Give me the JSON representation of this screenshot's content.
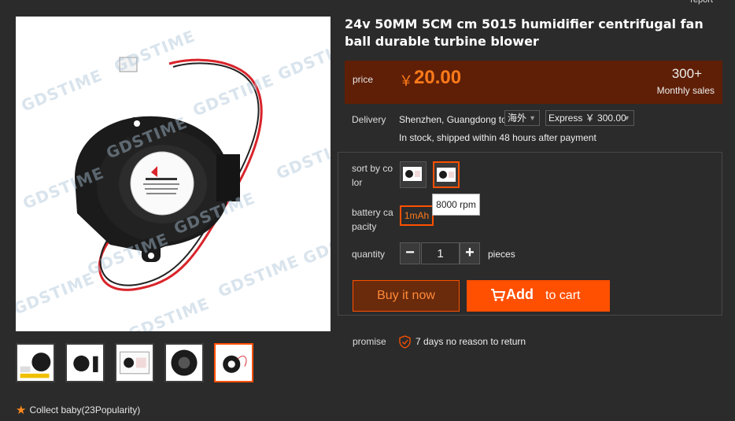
{
  "header": {
    "report_link": "report"
  },
  "product": {
    "title": "24v 50MM 5CM cm 5015 humidifier centrifugal fan ball durable turbine blower",
    "watermark": "GDSTIME",
    "fan_label": "GDSTIME"
  },
  "gallery": {
    "thumbnail_count": 5,
    "active_index": 4
  },
  "collect": {
    "label": "Collect baby(23Popularity)",
    "star_icon": "star-icon"
  },
  "price": {
    "label": "price",
    "currency_symbol": "￥",
    "value": "20.00",
    "sales_count": "300+",
    "sales_label": "Monthly sales",
    "background_color": "#5f1f06",
    "accent_color": "#ff7a1a"
  },
  "delivery": {
    "label": "Delivery",
    "from": "Shenzhen, Guangdong to",
    "destination": "海外",
    "shipping_option": "Express ￥ 300.00",
    "stock_text": "In stock, shipped within 48 hours after payment"
  },
  "options": {
    "color_label_line1": "sort by co",
    "color_label_line2": "lor",
    "color_swatch_count": 2,
    "selected_color_index": 1,
    "battery_label_line1": "battery ca",
    "battery_label_line2": "pacity",
    "battery_value": "1mAh",
    "tooltip": "8000 rpm",
    "quantity_label": "quantity",
    "quantity_value": "1",
    "quantity_unit": "pieces",
    "minus_symbol": "−",
    "plus_symbol": "+"
  },
  "actions": {
    "buy_label": "Buy it now",
    "add_label": "Add",
    "to_cart_label": "to cart",
    "primary_color": "#ff4f00"
  },
  "promise": {
    "label": "promise",
    "text": "7 days no reason to return",
    "icon": "shield-check-icon"
  }
}
